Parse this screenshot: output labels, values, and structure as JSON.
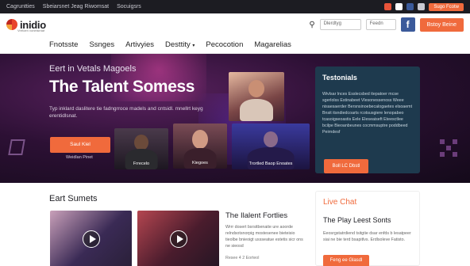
{
  "topbar": {
    "links": [
      "Cagruntties",
      "Sbeiarsnet Jeag Riwomsat",
      "Socuigsrs"
    ],
    "cta_label": "Sugo Fcotw"
  },
  "header": {
    "logo_text": "inidio",
    "logo_sub": "Vretoen vonelsintaf",
    "search_placeholder": "Dlerdtyg",
    "select_value": "Feedn",
    "fb_icon": "f",
    "cta_label": "Bstoy Beine"
  },
  "nav": {
    "items": [
      "Fnotsste",
      "Ssnges",
      "Artivyies",
      "Desttity",
      "Pecocotion",
      "Magarelias"
    ]
  },
  "hero": {
    "kicker": "Eert in Vetals Magoels",
    "title": "The Talent Somess",
    "description": "Typ inklard daslitere tie fadngrroce madels and cntsidl. mnellrt keyg erentidlsnat.",
    "button_label": "Saul Kiel",
    "button_sub": "Weidlan Pinet",
    "tiles": [
      {
        "caption": "Frrecelo"
      },
      {
        "caption": "Kiegoes"
      },
      {
        "caption": "Trortled Baop Enoates"
      }
    ]
  },
  "testimonials": {
    "title": "Testonials",
    "text": "Wivlsar lnces Esslecsbed itepatoer mcse sgerlolss Estinabeet Vlesonessenoss Weee nisaesaerder Bersnsinoebecalogaetes elsoaemt Bnsit itsndiedcoarts rcotsusgiere lenopabeo tcasoigseoastis Eele Eleseaiseft Eteesctlee bcilpe Bieoanbeunes cocmmsuptre poddbeed Peirndesf",
    "button_label": "Boll LC Dbstl"
  },
  "lower": {
    "section_title": "Eart Sumets",
    "article_title": "The Ilalent Fortlies",
    "article_text": "Wrrr dosert bsrsitbenaite ure aoorde relndsotsnorpig mostesenee bieteisio tieolbe bnieoigt ussseatue estetis sicr ons ne sieosd",
    "article_meta": "Resee 4 2 Eorteol",
    "live_title": "Live Chat",
    "live_sub": "The Play Leest Sonts",
    "live_text": "Eeosrgstatrdiend tsitgtie dsar enfds b lesatpeer siai ne bie terd bsapitlvs. Erdlsoleve Fatisto.",
    "live_button": "Feng ee Glasdl"
  },
  "colors": {
    "accent": "#f06a3c",
    "hero_bg": "#2c1034",
    "testimonial_bg": "#1e3a4e",
    "facebook": "#3b5a9a"
  }
}
